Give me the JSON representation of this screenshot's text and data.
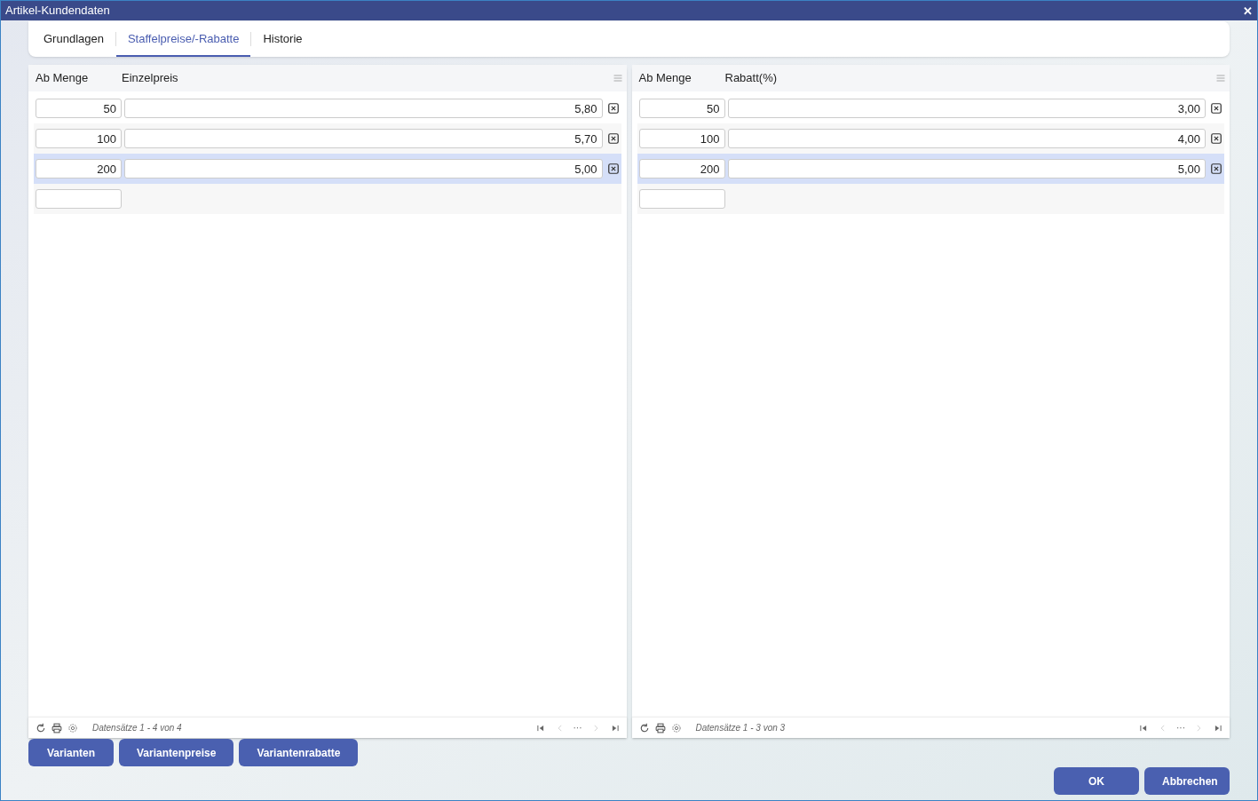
{
  "window": {
    "title": "Artikel-Kundendaten",
    "close": "✕"
  },
  "tabs": [
    {
      "label": "Grundlagen",
      "selected": false
    },
    {
      "label": "Staffelpreise/-Rabatte",
      "selected": true
    },
    {
      "label": "Historie",
      "selected": false
    }
  ],
  "grids": [
    {
      "columns": [
        "Ab Menge",
        "Einzelpreis"
      ],
      "rows": [
        {
          "quantity": "50",
          "value": "5,80",
          "selected": false
        },
        {
          "quantity": "100",
          "value": "5,70",
          "selected": false
        },
        {
          "quantity": "200",
          "value": "5,00",
          "selected": true
        }
      ],
      "footer": {
        "records": "Datensätze 1 - 4 von 4",
        "pager_more": "···"
      }
    },
    {
      "columns": [
        "Ab Menge",
        "Rabatt(%)"
      ],
      "rows": [
        {
          "quantity": "50",
          "value": "3,00",
          "selected": false
        },
        {
          "quantity": "100",
          "value": "4,00",
          "selected": false
        },
        {
          "quantity": "200",
          "value": "5,00",
          "selected": true
        }
      ],
      "footer": {
        "records": "Datensätze 1 - 3 von 3",
        "pager_more": "···"
      }
    }
  ],
  "variant_buttons": [
    "Varianten",
    "Variantenpreise",
    "Variantenrabatte"
  ],
  "dialog_buttons": [
    "OK",
    "Abbrechen"
  ]
}
